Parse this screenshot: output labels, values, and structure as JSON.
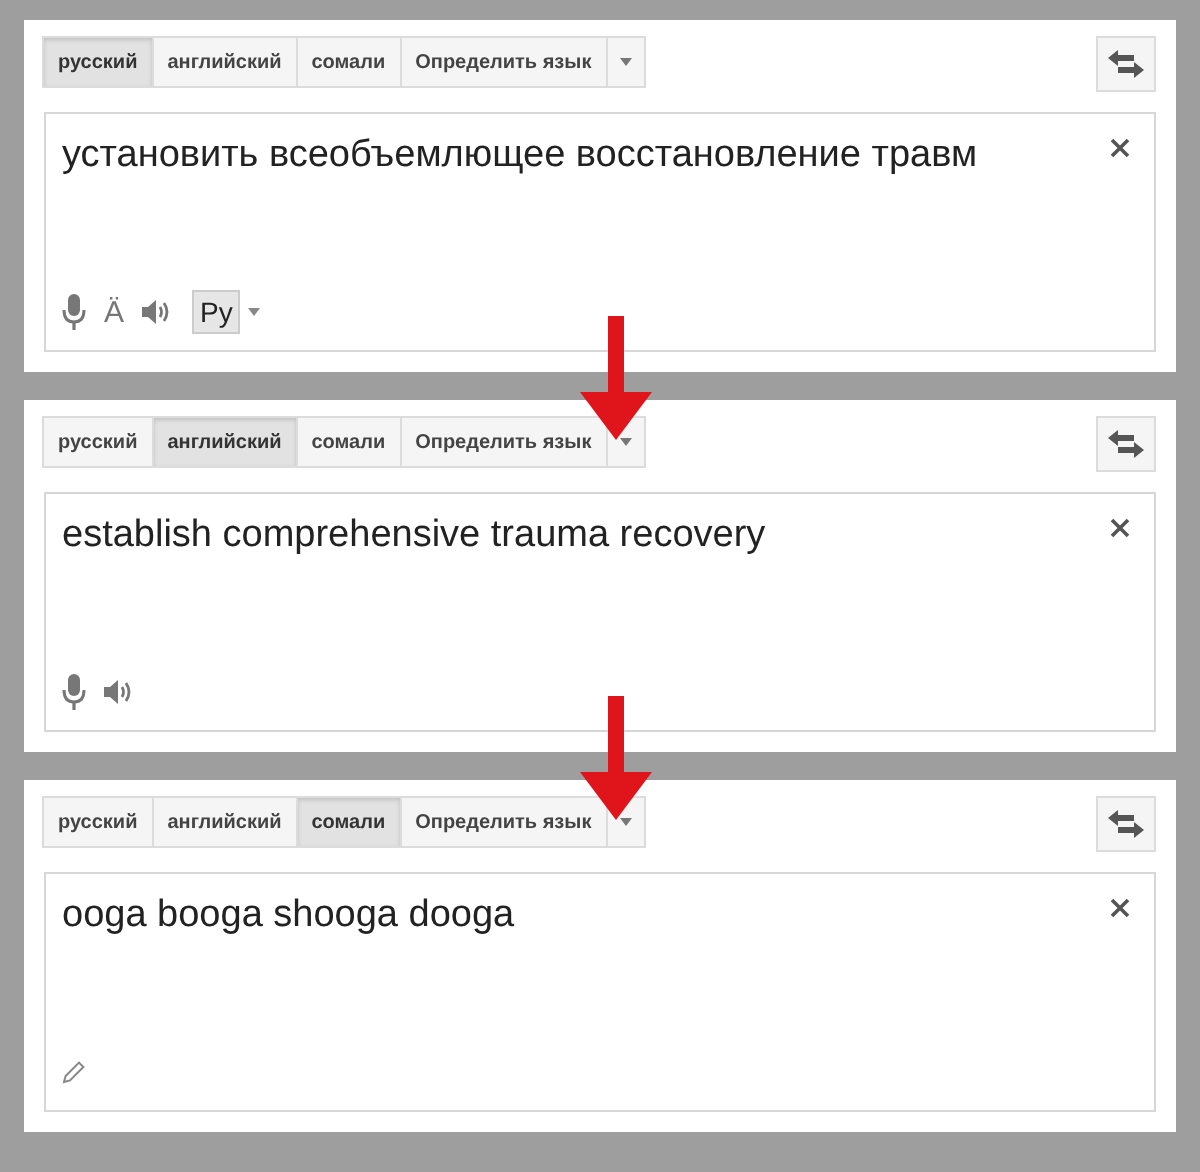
{
  "panels": [
    {
      "tabs": [
        {
          "label": "русский",
          "selected": true
        },
        {
          "label": "английский",
          "selected": false
        },
        {
          "label": "сомали",
          "selected": false
        },
        {
          "label": "Определить язык",
          "selected": false
        }
      ],
      "text": "установить всеобъемлющее восстановление травм",
      "tools": [
        {
          "kind": "mic"
        },
        {
          "kind": "keyboard",
          "label": "Ä"
        },
        {
          "kind": "speaker"
        },
        {
          "kind": "input",
          "label": "Ру"
        }
      ]
    },
    {
      "tabs": [
        {
          "label": "русский",
          "selected": false
        },
        {
          "label": "английский",
          "selected": true
        },
        {
          "label": "сомали",
          "selected": false
        },
        {
          "label": "Определить язык",
          "selected": false
        }
      ],
      "text": "establish comprehensive trauma recovery",
      "tools": [
        {
          "kind": "mic"
        },
        {
          "kind": "speaker"
        }
      ]
    },
    {
      "tabs": [
        {
          "label": "русский",
          "selected": false
        },
        {
          "label": "английский",
          "selected": false
        },
        {
          "label": "сомали",
          "selected": true
        },
        {
          "label": "Определить язык",
          "selected": false
        }
      ],
      "text": "ooga booga shooga dooga",
      "tools": [
        {
          "kind": "pencil"
        }
      ]
    }
  ]
}
